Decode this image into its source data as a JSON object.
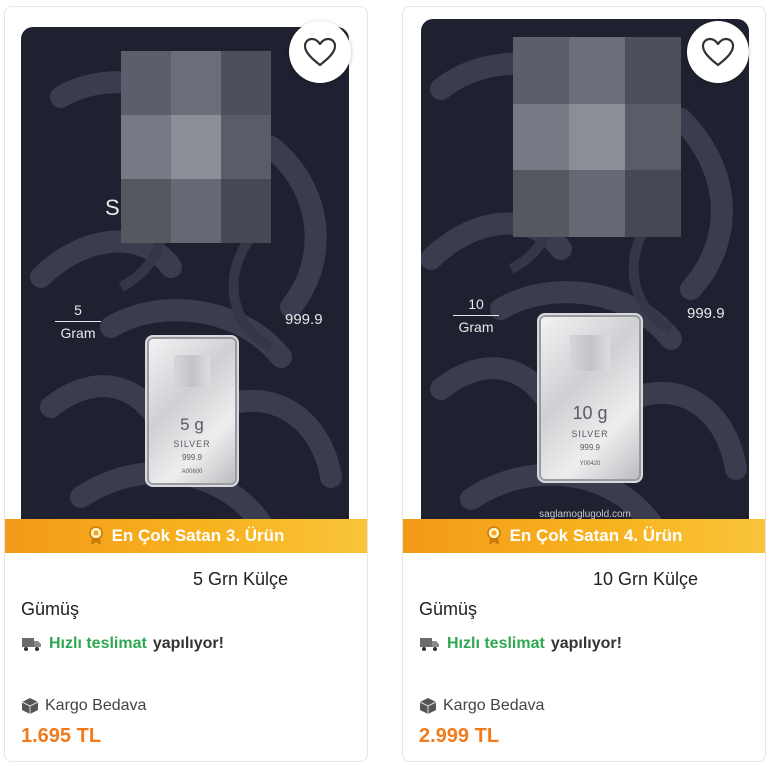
{
  "products": [
    {
      "package": {
        "weight_value": "5",
        "weight_unit": "Gram",
        "purity": "999.9",
        "bar_weight": "5 g",
        "bar_metal": "SILVER",
        "bar_purity": "999.9",
        "bar_serial": "A00600",
        "brand_partial": "S"
      },
      "badge_text": "En Çok Satan 3. Ürün",
      "title_line1": "5 Grn Külçe",
      "title_line2": "Gümüş",
      "delivery_highlight": "Hızlı teslimat",
      "delivery_rest": "yapılıyor!",
      "cargo_text": "Kargo Bedava",
      "price": "1.695 TL"
    },
    {
      "package": {
        "weight_value": "10",
        "weight_unit": "Gram",
        "purity": "999.9",
        "bar_weight": "10 g",
        "bar_metal": "SILVER",
        "bar_purity": "999.9",
        "bar_serial": "Y00420",
        "website": "saglamoglugold.com"
      },
      "badge_text": "En Çok Satan 4. Ürün",
      "title_line1": "10 Grn Külçe",
      "title_line2": "Gümüş",
      "delivery_highlight": "Hızlı teslimat",
      "delivery_rest": "yapılıyor!",
      "cargo_text": "Kargo Bedava",
      "price": "2.999 TL"
    }
  ],
  "icons": {
    "favorite": "heart-outline-icon",
    "badge": "medal-icon",
    "delivery": "truck-icon",
    "cargo": "box-icon"
  },
  "colors": {
    "price": "#f27a1a",
    "badge_start": "#f39a1a",
    "badge_end": "#f9c43a",
    "delivery_green": "#2fa84f",
    "package_bg": "#1f2130"
  }
}
